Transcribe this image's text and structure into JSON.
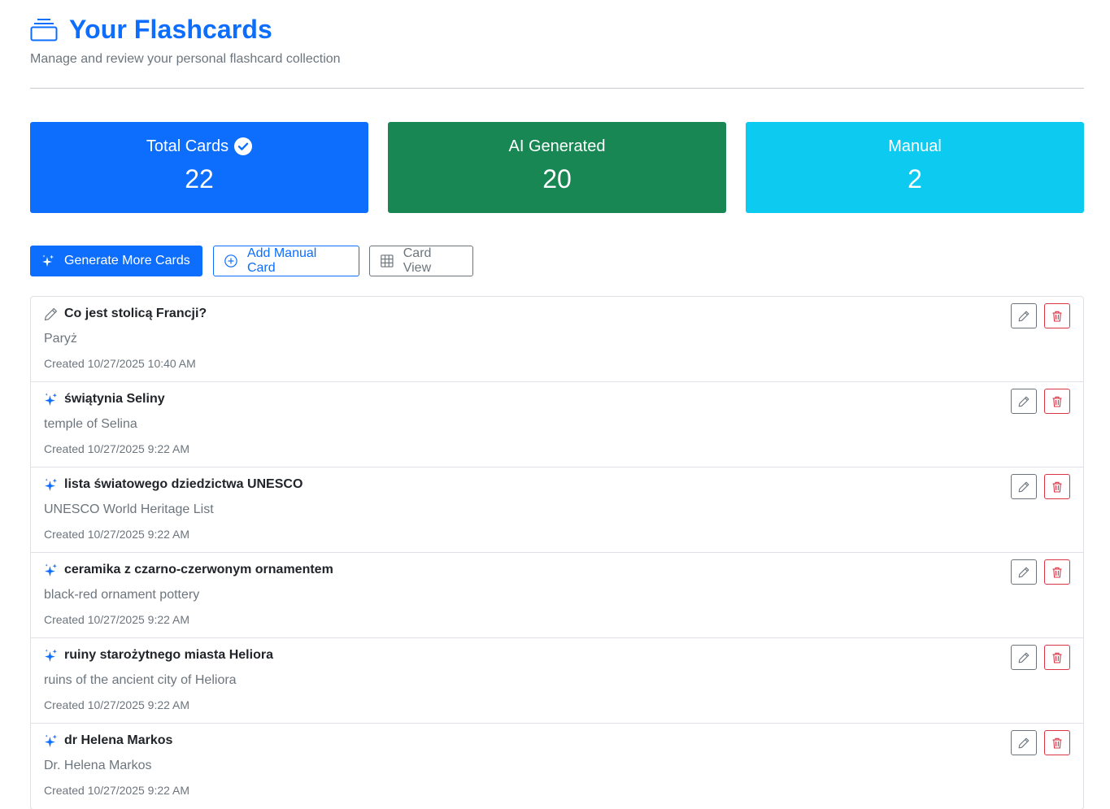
{
  "header": {
    "title": "Your Flashcards",
    "subtitle": "Manage and review your personal flashcard collection",
    "icon": "stack-icon"
  },
  "stats": {
    "total": {
      "label": "Total Cards",
      "value": "22",
      "icon": "check-circle-icon",
      "color": "#0d6efd"
    },
    "ai": {
      "label": "AI Generated",
      "value": "20",
      "color": "#198754"
    },
    "manual": {
      "label": "Manual",
      "value": "2",
      "color": "#0dcaf0"
    }
  },
  "actions": {
    "generate_label": "Generate More Cards",
    "add_label": "Add Manual Card",
    "view_label": "Card View"
  },
  "cards": [
    {
      "type": "manual",
      "front": "Co jest stolicą Francji?",
      "back": "Paryż",
      "created": "Created 10/27/2025 10:40 AM"
    },
    {
      "type": "ai",
      "front": "świątynia Seliny",
      "back": "temple of Selina",
      "created": "Created 10/27/2025 9:22 AM"
    },
    {
      "type": "ai",
      "front": "lista światowego dziedzictwa UNESCO",
      "back": "UNESCO World Heritage List",
      "created": "Created 10/27/2025 9:22 AM"
    },
    {
      "type": "ai",
      "front": "ceramika z czarno-czerwonym ornamentem",
      "back": "black-red ornament pottery",
      "created": "Created 10/27/2025 9:22 AM"
    },
    {
      "type": "ai",
      "front": "ruiny starożytnego miasta Heliora",
      "back": "ruins of the ancient city of Heliora",
      "created": "Created 10/27/2025 9:22 AM"
    },
    {
      "type": "ai",
      "front": "dr Helena Markos",
      "back": "Dr. Helena Markos",
      "created": "Created 10/27/2025 9:22 AM"
    }
  ],
  "colors": {
    "primary": "#0d6efd",
    "danger": "#dc3545",
    "secondary": "#6c757d"
  }
}
